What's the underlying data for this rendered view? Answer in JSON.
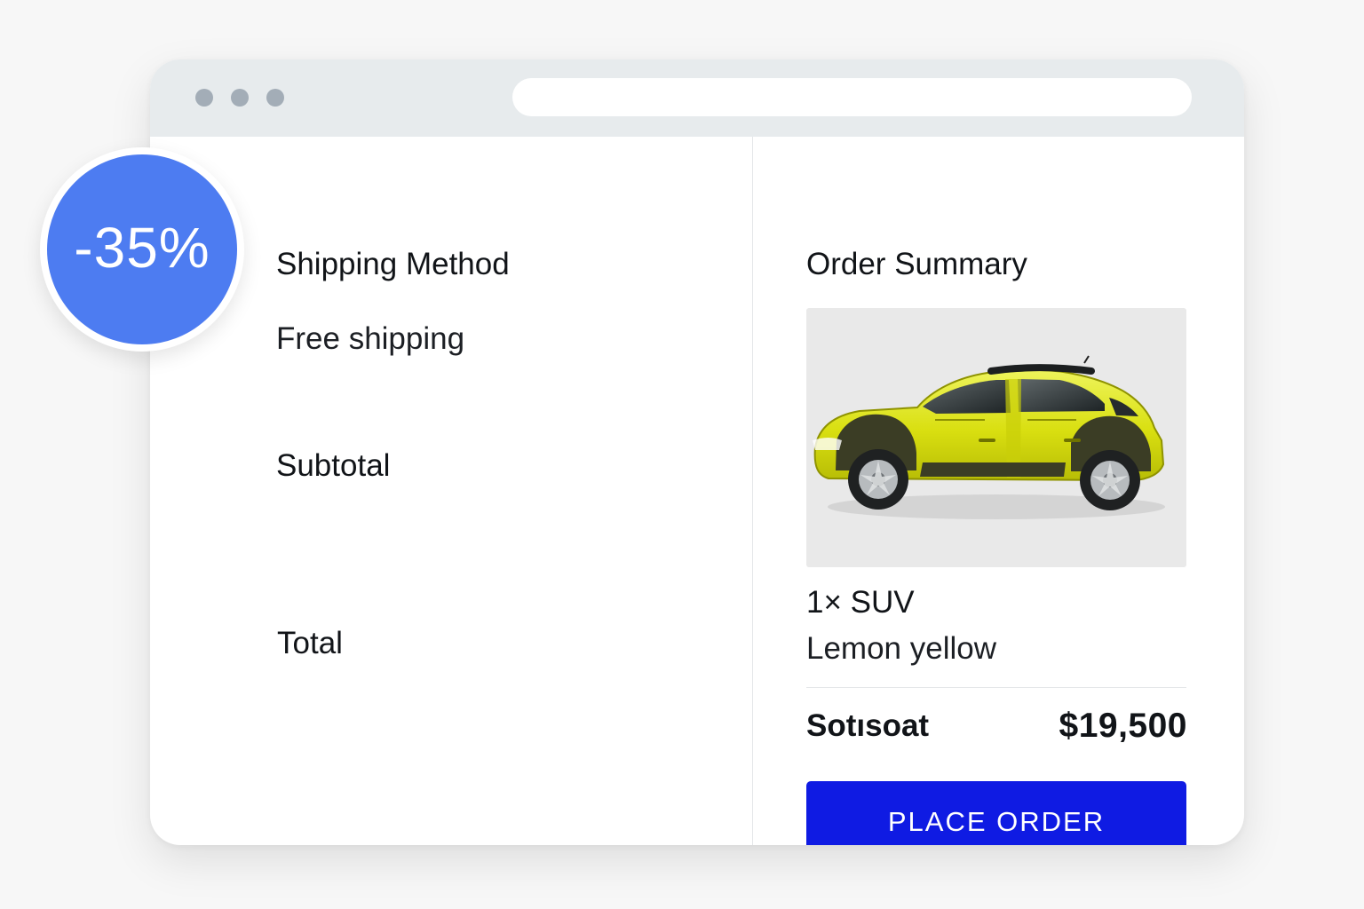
{
  "badge": {
    "text": "-35%",
    "color": "#4d7cf1"
  },
  "window": {
    "controls": [
      "window-dot",
      "window-dot",
      "window-dot"
    ],
    "address_bar_value": ""
  },
  "shipping": {
    "heading": "Shipping Method",
    "method": "Free shipping"
  },
  "totals": {
    "subtotal_label": "Subtotal",
    "total_label": "Total"
  },
  "order_summary": {
    "title": "Order Summary",
    "item": {
      "quantity_name": "1× SUV",
      "color_name": "Lemon yellow",
      "image_icon": "yellow-suv-image"
    },
    "subtotal_label": "Sotısoat",
    "subtotal_value": "$19,500",
    "button_label": "PLACE ORDER",
    "button_color": "#0f1be3"
  }
}
